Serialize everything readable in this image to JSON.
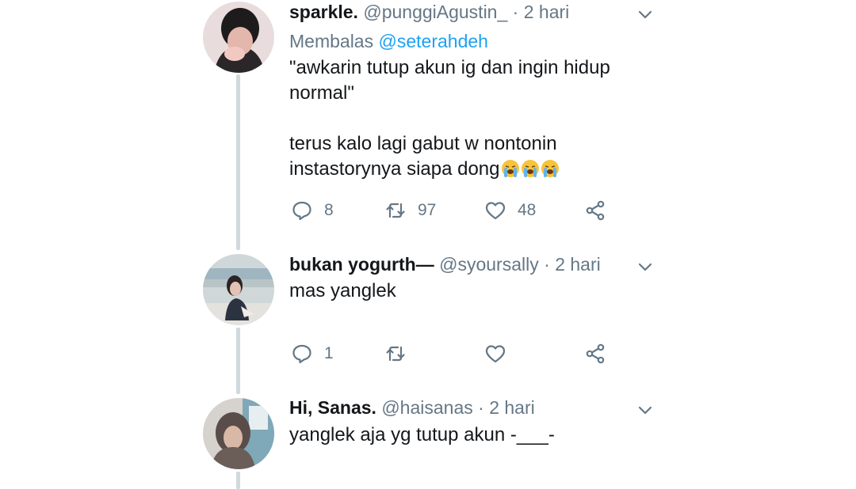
{
  "tweets": [
    {
      "name": "sparkle.",
      "handle": "@punggiAgustin_",
      "separator": "·",
      "time": "2 hari",
      "replying_prefix": "Membalas",
      "replying_to": "@seterahdeh",
      "text_lines": [
        "\"awkarin tutup akun ig dan ingin hidup",
        "normal\"",
        "",
        "terus kalo lagi gabut w nontonin",
        "instastorynya siapa dong"
      ],
      "emoji": "loudly-crying-face",
      "replies": "8",
      "retweets": "97",
      "likes": "48"
    },
    {
      "name": "bukan yogurth—",
      "handle": "@syoursally",
      "separator": "·",
      "time": "2 hari",
      "text_lines": [
        "mas yanglek"
      ],
      "replies": "1",
      "retweets": "",
      "likes": ""
    },
    {
      "name": "Hi, Sanas.",
      "handle": "@haisanas",
      "separator": "·",
      "time": "2 hari",
      "text_lines": [
        "yanglek aja yg tutup akun -___-"
      ]
    }
  ],
  "colors": {
    "text": "#14171a",
    "secondary": "#657786",
    "link": "#1da1f2",
    "thread_line": "#cfd9de"
  },
  "icons": [
    "reply-icon",
    "retweet-icon",
    "like-icon",
    "share-icon",
    "chevron-down-icon"
  ]
}
